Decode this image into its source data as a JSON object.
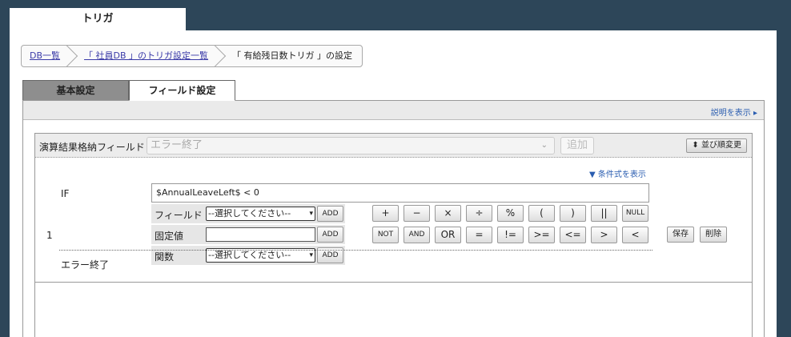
{
  "top_tab": "トリガ",
  "breadcrumb": [
    "DB一覧",
    "「 社員DB 」のトリガ設定一覧",
    "「 有給残日数トリガ 」の設定"
  ],
  "tabs": [
    "基本設定",
    "フィールド設定"
  ],
  "show_description": "説明を表示 ▸",
  "result_field_label": "演算結果格納フィールド",
  "result_field_value": "エラー終了",
  "add_label": "追加",
  "sort_label": "並び順変更",
  "show_condition": "▼ 条件式を表示",
  "if_label": "IF",
  "row_number": "1",
  "expression": "$AnnualLeaveLeft$  < 0",
  "rows": {
    "field": {
      "label": "フィールド",
      "select": "--選択してください--",
      "add": "ADD"
    },
    "fixed": {
      "label": "固定値",
      "add": "ADD"
    },
    "function": {
      "label": "関数",
      "select": "--選択してください--",
      "add": "ADD"
    }
  },
  "operators_row1": [
    "+",
    "−",
    "×",
    "÷",
    "%",
    "(",
    ")",
    "||",
    "NULL"
  ],
  "operators_row2": [
    "NOT",
    "AND",
    "OR",
    "=",
    "!=",
    ">=",
    "<=",
    ">",
    "<"
  ],
  "save_label": "保存",
  "delete_label": "削除",
  "else_label": "エラー終了",
  "icons": {
    "sort": "updown-arrow-icon",
    "chevron": "chevron-down-icon"
  }
}
